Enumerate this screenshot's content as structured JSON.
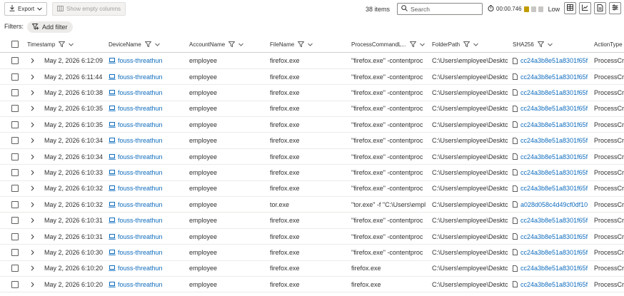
{
  "toolbar": {
    "export_label": "Export",
    "show_empty_label": "Show empty columns",
    "items_count": "38 items",
    "search_placeholder": "Search",
    "timer": "00:00.746",
    "perf_level": "Low"
  },
  "filters": {
    "label": "Filters:",
    "add_filter_label": "Add filter"
  },
  "table": {
    "columns": [
      "Timestamp",
      "DeviceName",
      "AccountName",
      "FileName",
      "ProcessCommandL...",
      "FolderPath",
      "SHA256",
      "ActionType"
    ],
    "rows": [
      {
        "timestamp": "May 2, 2026 6:12:09",
        "device": "fouss-threathun",
        "account": "employee",
        "file": "firefox.exe",
        "cmd": "\"firefox.exe\" -contentproc",
        "folder": "C:\\Users\\employee\\Desktc",
        "sha": "cc24a3b8e51a8301f65f",
        "action": "ProcessCre"
      },
      {
        "timestamp": "May 2, 2026 6:11:44",
        "device": "fouss-threathun",
        "account": "employee",
        "file": "firefox.exe",
        "cmd": "\"firefox.exe\" -contentproc",
        "folder": "C:\\Users\\employee\\Desktc",
        "sha": "cc24a3b8e51a8301f65f",
        "action": "ProcessCre"
      },
      {
        "timestamp": "May 2, 2026 6:10:38",
        "device": "fouss-threathun",
        "account": "employee",
        "file": "firefox.exe",
        "cmd": "\"firefox.exe\" -contentproc",
        "folder": "C:\\Users\\employee\\Desktc",
        "sha": "cc24a3b8e51a8301f65f",
        "action": "ProcessCre"
      },
      {
        "timestamp": "May 2, 2026 6:10:35",
        "device": "fouss-threathun",
        "account": "employee",
        "file": "firefox.exe",
        "cmd": "\"firefox.exe\" -contentproc",
        "folder": "C:\\Users\\employee\\Desktc",
        "sha": "cc24a3b8e51a8301f65f",
        "action": "ProcessCre"
      },
      {
        "timestamp": "May 2, 2026 6:10:35",
        "device": "fouss-threathun",
        "account": "employee",
        "file": "firefox.exe",
        "cmd": "\"firefox.exe\" -contentproc",
        "folder": "C:\\Users\\employee\\Desktc",
        "sha": "cc24a3b8e51a8301f65f",
        "action": "ProcessCre"
      },
      {
        "timestamp": "May 2, 2026 6:10:34",
        "device": "fouss-threathun",
        "account": "employee",
        "file": "firefox.exe",
        "cmd": "\"firefox.exe\" -contentproc",
        "folder": "C:\\Users\\employee\\Desktc",
        "sha": "cc24a3b8e51a8301f65f",
        "action": "ProcessCre"
      },
      {
        "timestamp": "May 2, 2026 6:10:34",
        "device": "fouss-threathun",
        "account": "employee",
        "file": "firefox.exe",
        "cmd": "\"firefox.exe\" -contentproc",
        "folder": "C:\\Users\\employee\\Desktc",
        "sha": "cc24a3b8e51a8301f65f",
        "action": "ProcessCre"
      },
      {
        "timestamp": "May 2, 2026 6:10:33",
        "device": "fouss-threathun",
        "account": "employee",
        "file": "firefox.exe",
        "cmd": "\"firefox.exe\" -contentproc",
        "folder": "C:\\Users\\employee\\Desktc",
        "sha": "cc24a3b8e51a8301f65f",
        "action": "ProcessCre"
      },
      {
        "timestamp": "May 2, 2026 6:10:32",
        "device": "fouss-threathun",
        "account": "employee",
        "file": "firefox.exe",
        "cmd": "\"firefox.exe\" -contentproc",
        "folder": "C:\\Users\\employee\\Desktc",
        "sha": "cc24a3b8e51a8301f65f",
        "action": "ProcessCre"
      },
      {
        "timestamp": "May 2, 2026 6:10:32",
        "device": "fouss-threathun",
        "account": "employee",
        "file": "tor.exe",
        "cmd": "\"tor.exe\" -f \"C:\\Users\\empl",
        "folder": "C:\\Users\\employee\\Desktc",
        "sha": "a028d058c4d49cf0df10",
        "action": "ProcessCre"
      },
      {
        "timestamp": "May 2, 2026 6:10:31",
        "device": "fouss-threathun",
        "account": "employee",
        "file": "firefox.exe",
        "cmd": "\"firefox.exe\" -contentproc",
        "folder": "C:\\Users\\employee\\Desktc",
        "sha": "cc24a3b8e51a8301f65f",
        "action": "ProcessCre"
      },
      {
        "timestamp": "May 2, 2026 6:10:31",
        "device": "fouss-threathun",
        "account": "employee",
        "file": "firefox.exe",
        "cmd": "\"firefox.exe\" -contentproc",
        "folder": "C:\\Users\\employee\\Desktc",
        "sha": "cc24a3b8e51a8301f65f",
        "action": "ProcessCre"
      },
      {
        "timestamp": "May 2, 2026 6:10:30",
        "device": "fouss-threathun",
        "account": "employee",
        "file": "firefox.exe",
        "cmd": "\"firefox.exe\" -contentproc",
        "folder": "C:\\Users\\employee\\Desktc",
        "sha": "cc24a3b8e51a8301f65f",
        "action": "ProcessCre"
      },
      {
        "timestamp": "May 2, 2026 6:10:20",
        "device": "fouss-threathun",
        "account": "employee",
        "file": "firefox.exe",
        "cmd": "firefox.exe",
        "folder": "C:\\Users\\employee\\Desktc",
        "sha": "cc24a3b8e51a8301f65f",
        "action": "ProcessCre"
      },
      {
        "timestamp": "May 2, 2026 6:10:20",
        "device": "fouss-threathun",
        "account": "employee",
        "file": "firefox.exe",
        "cmd": "firefox.exe",
        "folder": "C:\\Users\\employee\\Desktc",
        "sha": "cc24a3b8e51a8301f65f",
        "action": "ProcessCre"
      }
    ]
  },
  "colors": {
    "link": "#0f6cbd",
    "perf_filled": "#c19c00",
    "perf_empty": "#c8c6c4"
  },
  "icons": {
    "export": "download-icon",
    "show_empty": "columns-icon",
    "search": "search-icon",
    "timer": "stopwatch-icon",
    "add_filter": "funnel-plus-icon",
    "column_filter": "funnel-icon",
    "column_sort": "chevron-down-icon",
    "row_expand": "chevron-right-icon",
    "device": "laptop-icon",
    "file": "document-icon"
  }
}
